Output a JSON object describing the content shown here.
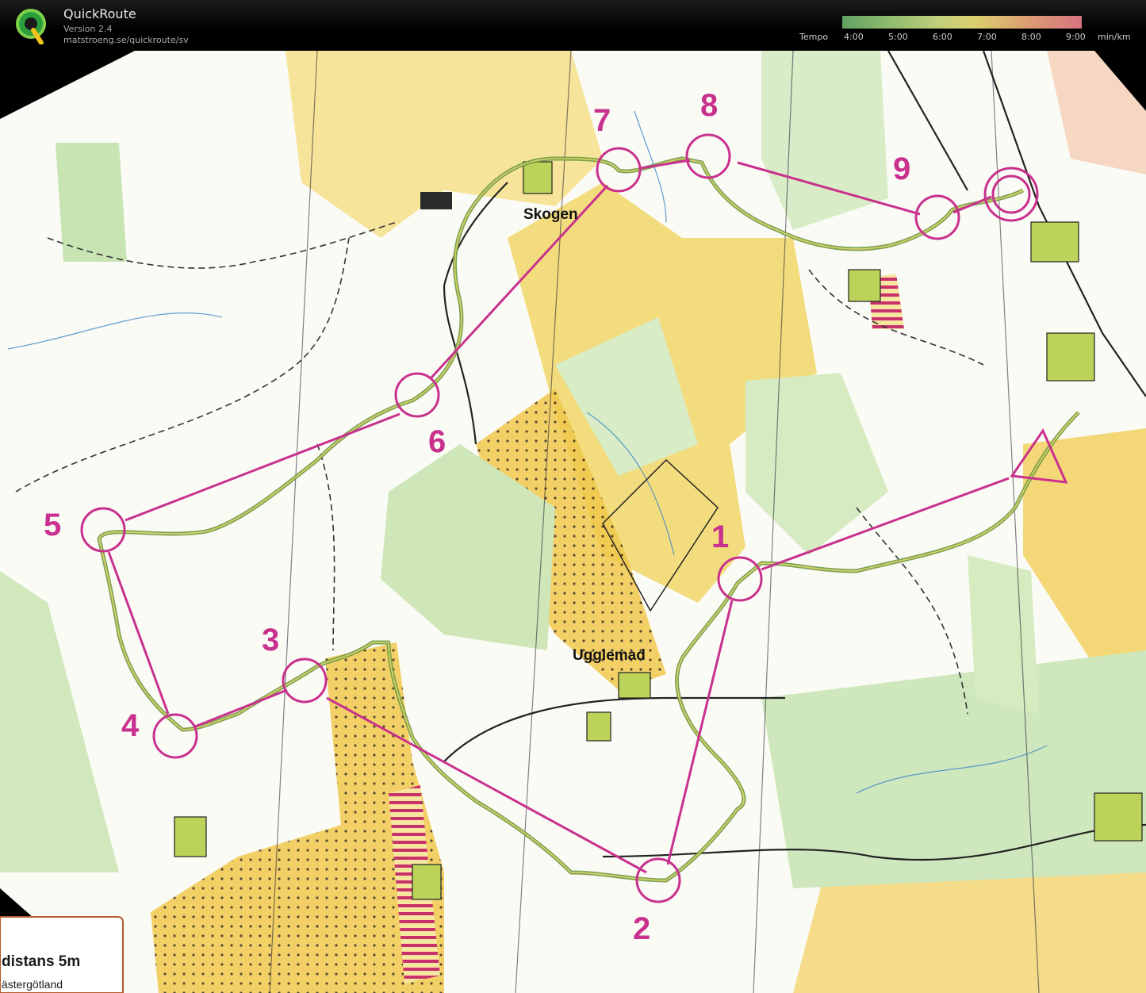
{
  "app": {
    "title": "QuickRoute",
    "version": "Version 2.4",
    "url": "matstroeng.se/quickroute/sv"
  },
  "tempo": {
    "label": "Tempo",
    "ticks": [
      "4:00",
      "5:00",
      "6:00",
      "7:00",
      "8:00",
      "9:00"
    ],
    "unit": "min/km"
  },
  "map": {
    "controls": [
      "1",
      "2",
      "3",
      "4",
      "5",
      "6",
      "7",
      "8",
      "9"
    ],
    "place_labels": [
      "Skogen",
      "Ugglemad"
    ],
    "legend": {
      "title": "distans 5m",
      "subtitle": "ästergötland"
    }
  },
  "colors": {
    "course": "#c8318d",
    "route": "#6f9a45",
    "open_land": "#f1d35f",
    "forest": "#ffffff",
    "green": "#bfe0a8"
  }
}
